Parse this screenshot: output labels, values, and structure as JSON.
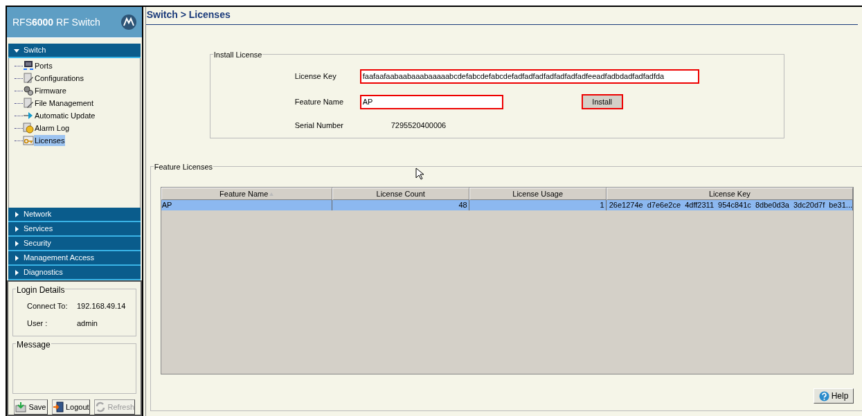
{
  "sidebar": {
    "title": "RFS**6000** RF Switch",
    "sections": [
      {
        "label": "Switch",
        "expanded": true,
        "items": [
          {
            "label": "Ports",
            "selected": false
          },
          {
            "label": "Configurations",
            "selected": false
          },
          {
            "label": "Firmware",
            "selected": false
          },
          {
            "label": "File Management",
            "selected": false
          },
          {
            "label": "Automatic Update",
            "selected": false
          },
          {
            "label": "Alarm Log",
            "selected": false
          },
          {
            "label": "Licenses",
            "selected": true
          }
        ]
      },
      {
        "label": "Network",
        "expanded": false
      },
      {
        "label": "Services",
        "expanded": false
      },
      {
        "label": "Security",
        "expanded": false
      },
      {
        "label": "Management Access",
        "expanded": false
      },
      {
        "label": "Diagnostics",
        "expanded": false
      }
    ],
    "login_details": {
      "title": "Login Details",
      "fields": [
        {
          "label": "Connect To:",
          "value": "192.168.49.14"
        },
        {
          "label": "User :",
          "value": "admin"
        }
      ]
    },
    "message": {
      "title": "Message"
    },
    "buttons": [
      {
        "label": "Save",
        "disabled": false
      },
      {
        "label": "Logout",
        "disabled": false
      },
      {
        "label": "Refresh",
        "disabled": true
      }
    ]
  },
  "page_title": "Switch > Licenses",
  "install_license": {
    "title": "Install License",
    "license_key": {
      "label": "License Key",
      "value": "faafaafaabaabaaabaaaaabcdefabcdefabcdefadfadfadfadfadfadfadfeeadfadbdadfadfadfda"
    },
    "feature_name": {
      "label": "Feature Name",
      "value": "AP"
    },
    "install_button": "Install",
    "serial_number": {
      "label": "Serial Number",
      "value": "7295520400006"
    }
  },
  "feature_licenses": {
    "title": "Feature Licenses",
    "columns": [
      {
        "label": "Feature Name",
        "sorted": true
      },
      {
        "label": "License Count",
        "sorted": false
      },
      {
        "label": "License Usage",
        "sorted": false
      },
      {
        "label": "License Key",
        "sorted": false
      }
    ],
    "rows": [
      {
        "selected": true,
        "cells": [
          "AP",
          "48",
          "1",
          "26e1274e  d7e6e2ce  4dff2311  954c841c  8dbe0d3a  3dc20d7f  be31..."
        ]
      }
    ]
  },
  "help_button": "Help"
}
